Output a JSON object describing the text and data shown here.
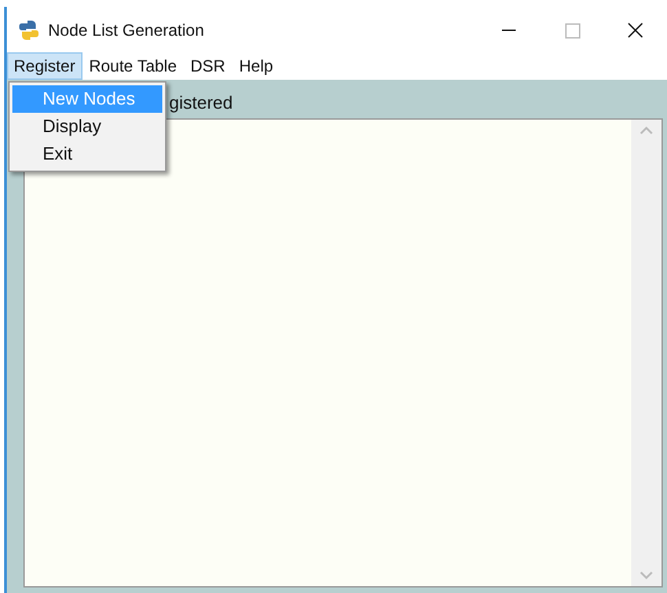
{
  "window": {
    "title": "Node List Generation"
  },
  "menu_bar": [
    {
      "label": "Register",
      "selected": true
    },
    {
      "label": "Route Table",
      "selected": false
    },
    {
      "label": "DSR",
      "selected": false
    },
    {
      "label": "Help",
      "selected": false
    }
  ],
  "dropdown": [
    {
      "label": "New Nodes",
      "selected": true
    },
    {
      "label": "Display",
      "selected": false
    },
    {
      "label": "Exit",
      "selected": false
    }
  ],
  "content": {
    "label": "gistered"
  }
}
